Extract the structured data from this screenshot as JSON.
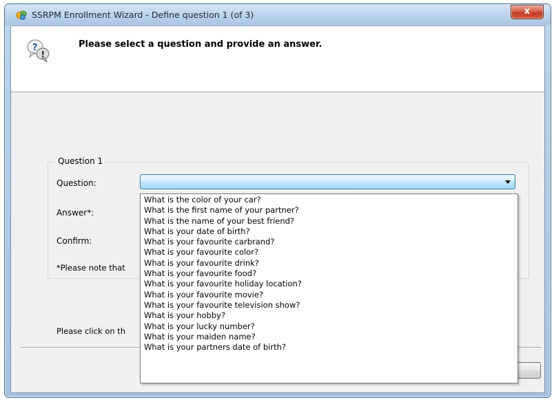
{
  "window": {
    "title": "SSRPM Enrollment Wizard - Define question 1 (of 3)",
    "close_label": "x"
  },
  "header": {
    "instruction": "Please select a question and provide an answer."
  },
  "group": {
    "legend": "Question 1",
    "question_label": "Question:",
    "answer_label": "Answer*:",
    "confirm_label": "Confirm:",
    "note_text": "*Please note that"
  },
  "question_combo": {
    "selected_value": ""
  },
  "dropdown": {
    "options": [
      "What is the color of your car?",
      "What is the first name of your partner?",
      "What is the name of your best friend?",
      "What is your date of birth?",
      "What is your favourite carbrand?",
      "What is your favourite color?",
      "What is your favourite drink?",
      "What is your favourite food?",
      "What is your favourite holiday location?",
      "What is your favourite movie?",
      "What is your favourite television show?",
      "What is your hobby?",
      "What is your lucky number?",
      "What is your maiden name?",
      "What is your partners date of birth?"
    ]
  },
  "footer": {
    "instruction_text": "Please click on th"
  }
}
